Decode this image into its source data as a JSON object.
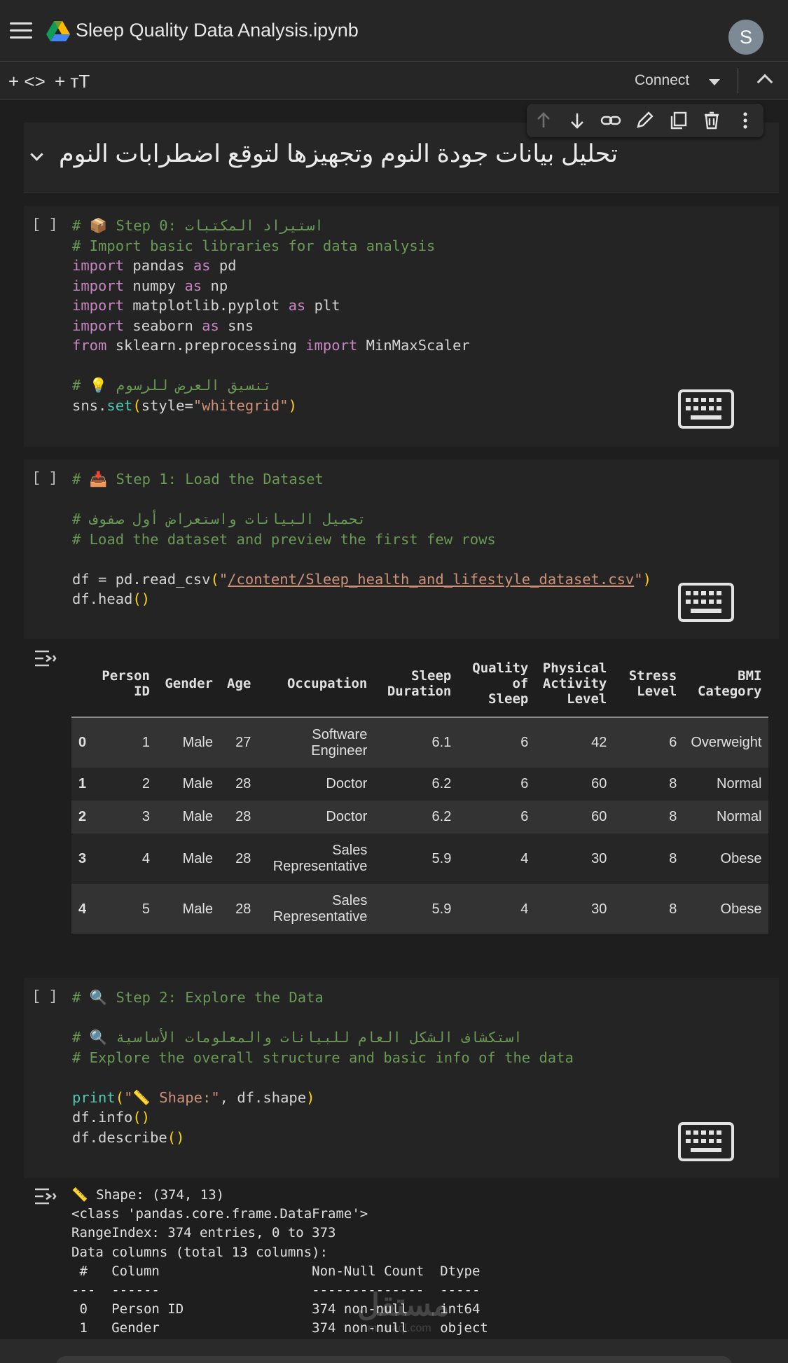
{
  "header": {
    "title": "Sleep Quality Data Analysis.ipynb",
    "avatar_letter": "S"
  },
  "toolbar": {
    "add_code": "+ <>",
    "add_text": "+ тT",
    "connect": "Connect"
  },
  "text_cell": {
    "heading": "تحليل بيانات جودة النوم وتجهيزها لتوقع اضطرابات النوم"
  },
  "cells": [
    {
      "bracket": "[ ]"
    },
    {
      "bracket": "[ ]"
    },
    {
      "bracket": "[ ]"
    }
  ],
  "dataframe": {
    "columns": [
      "",
      "Person ID",
      "Gender",
      "Age",
      "Occupation",
      "Sleep Duration",
      "Quality of Sleep",
      "Physical Activity Level",
      "Stress Level",
      "BMI Category"
    ],
    "rows": [
      [
        "0",
        "1",
        "Male",
        "27",
        "Software Engineer",
        "6.1",
        "6",
        "42",
        "6",
        "Overweight"
      ],
      [
        "1",
        "2",
        "Male",
        "28",
        "Doctor",
        "6.2",
        "6",
        "60",
        "8",
        "Normal"
      ],
      [
        "2",
        "3",
        "Male",
        "28",
        "Doctor",
        "6.2",
        "6",
        "60",
        "8",
        "Normal"
      ],
      [
        "3",
        "4",
        "Male",
        "28",
        "Sales Representative",
        "5.9",
        "4",
        "30",
        "8",
        "Obese"
      ],
      [
        "4",
        "5",
        "Male",
        "28",
        "Sales Representative",
        "5.9",
        "4",
        "30",
        "8",
        "Obese"
      ]
    ]
  },
  "text_output": [
    "📏 Shape: (374, 13)",
    "<class 'pandas.core.frame.DataFrame'>",
    "RangeIndex: 374 entries, 0 to 373",
    "Data columns (total 13 columns):",
    " #   Column                   Non-Null Count  Dtype ",
    "---  ------                   --------------  ----- ",
    " 0   Person ID                374 non-null    int64 ",
    " 1   Gender                   374 non-null    object"
  ],
  "watermark": {
    "brand": "مستقل",
    "url": "mostaql.com"
  },
  "colors": {
    "comment": "#6a9955",
    "keyword": "#c586c0",
    "string": "#ce9178",
    "function": "#4ec9b0",
    "paren": "#ffd700",
    "background": "#1e1e1e"
  }
}
